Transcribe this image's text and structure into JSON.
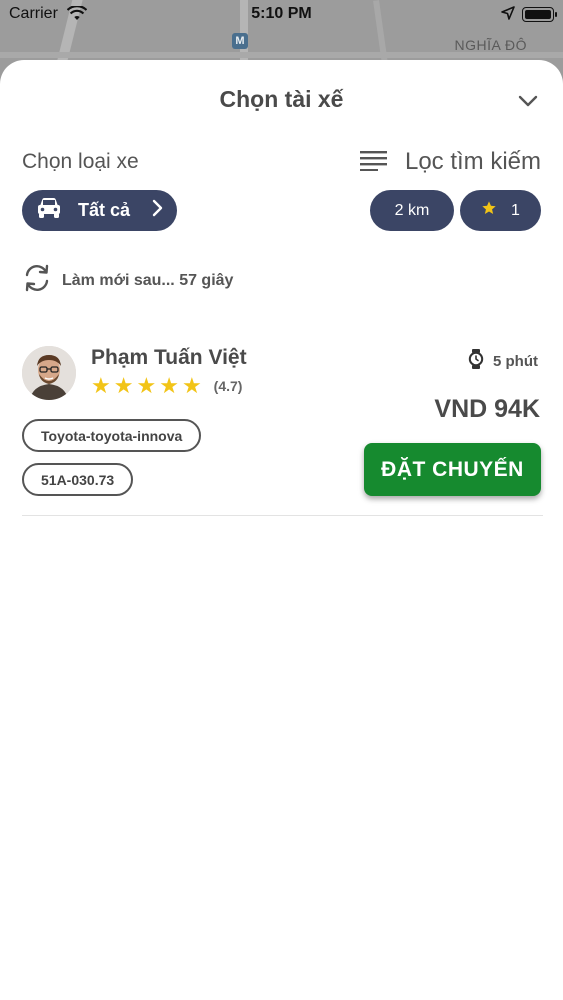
{
  "status_bar": {
    "carrier": "Carrier",
    "time": "5:10 PM"
  },
  "map": {
    "place_label": "NGHĨA ĐÔ",
    "metro_badge": "M"
  },
  "sheet": {
    "title": "Chọn tài xế"
  },
  "vehicle_type": {
    "label": "Chọn loại xe",
    "selected": "Tất cả"
  },
  "filter": {
    "label": "Lọc tìm kiếm",
    "distance": "2 km",
    "min_rating": "1"
  },
  "refresh": {
    "text": "Làm mới sau... 57 giây"
  },
  "driver": {
    "name": "Phạm Tuấn Việt",
    "rating_text": "(4.7)",
    "stars": 5,
    "eta": "5 phút",
    "price": "VND 94K",
    "car_model": "Toyota-toyota-innova",
    "plate": "51A-030.73",
    "book_label": "ĐẶT CHUYẾN"
  },
  "colors": {
    "pill_bg": "#3b4565",
    "book_bg": "#168a2f",
    "star": "#f2c417"
  }
}
